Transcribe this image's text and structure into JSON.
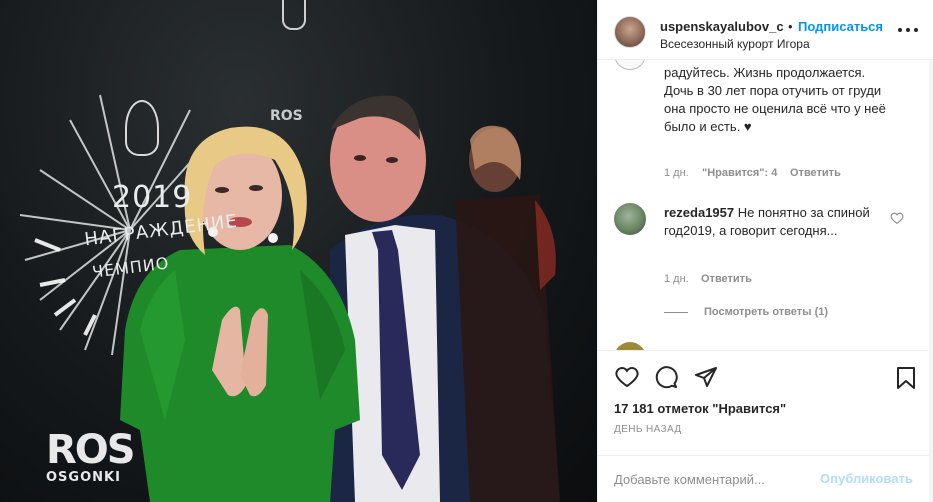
{
  "header": {
    "username": "uspenskayalubov_c",
    "separator": "•",
    "follow_label": "Подписаться",
    "location": "Всесезонный курорт Игора"
  },
  "photo": {
    "year": "2019",
    "award": "НАГРАЖДЕНИЕ",
    "champ": "ЧЕМПИО",
    "brand_big": "ROS",
    "brand_small": "OSGONKI",
    "ros_small": "ROS"
  },
  "comments": {
    "top_text": "радуйтесь. Жизнь продолжается. Дочь в 30 лет пора отучить от груди она просто не оценила всё что у неё было и есть. ♥",
    "top_meta": {
      "time": "1 дн.",
      "likes": "\"Нравится\": 4",
      "reply": "Ответить"
    },
    "second": {
      "author": "rezeda1957",
      "text": "Не понятно за спиной год2019, а говорит сегодня...",
      "time": "1 дн.",
      "reply": "Ответить"
    },
    "view_replies": "Посмотреть ответы (1)"
  },
  "actions": {
    "likes": "17 181 отметок \"Нравится\"",
    "date": "ДЕНЬ НАЗАД",
    "comment_placeholder": "Добавьте комментарий...",
    "publish_label": "Опубликовать"
  },
  "colors": {
    "accent": "#0095f6",
    "publish_disabled": "#b3dbff",
    "dress": "#1f8a2a"
  }
}
